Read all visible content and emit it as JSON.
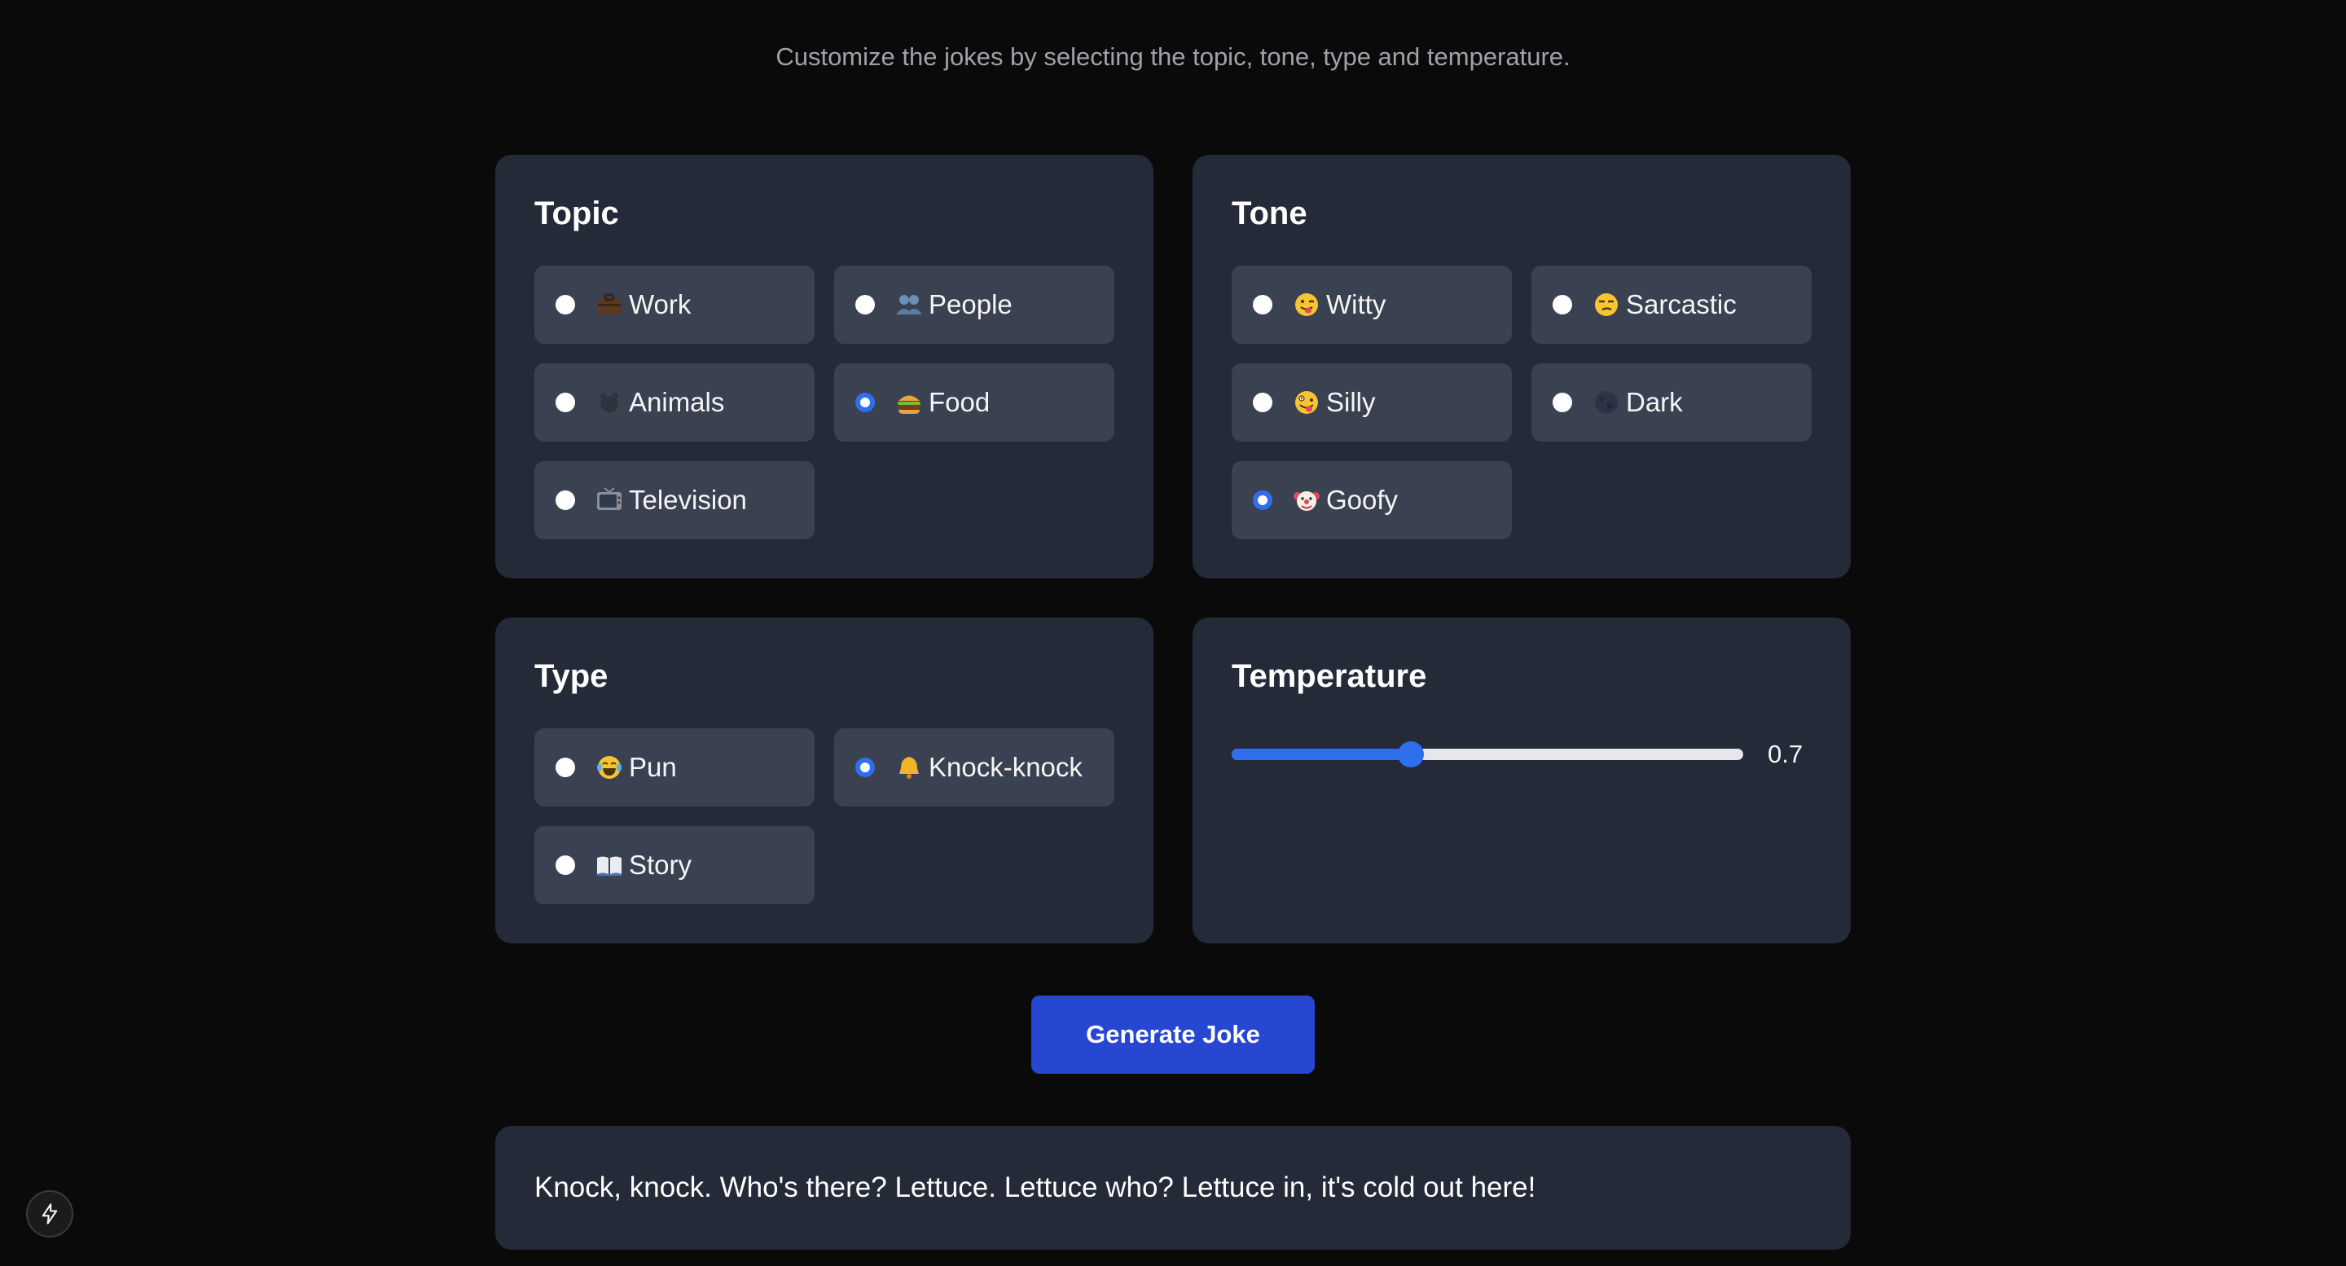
{
  "subtitle": "Customize the jokes by selecting the topic, tone, type and temperature.",
  "topic": {
    "title": "Topic",
    "options": [
      {
        "label": "Work",
        "icon": "briefcase-icon",
        "checked": false
      },
      {
        "label": "People",
        "icon": "people-icon",
        "checked": false
      },
      {
        "label": "Animals",
        "icon": "animal-icon",
        "checked": false
      },
      {
        "label": "Food",
        "icon": "burger-icon",
        "checked": true
      },
      {
        "label": "Television",
        "icon": "television-icon",
        "checked": false
      }
    ]
  },
  "tone": {
    "title": "Tone",
    "options": [
      {
        "label": "Witty",
        "icon": "winking-tongue-face-icon",
        "checked": false
      },
      {
        "label": "Sarcastic",
        "icon": "unamused-face-icon",
        "checked": false
      },
      {
        "label": "Silly",
        "icon": "zany-face-icon",
        "checked": false
      },
      {
        "label": "Dark",
        "icon": "new-moon-icon",
        "checked": false
      },
      {
        "label": "Goofy",
        "icon": "clown-face-icon",
        "checked": true
      }
    ]
  },
  "type": {
    "title": "Type",
    "options": [
      {
        "label": "Pun",
        "icon": "tears-of-joy-icon",
        "checked": false
      },
      {
        "label": "Knock-knock",
        "icon": "bell-icon",
        "checked": true
      },
      {
        "label": "Story",
        "icon": "open-book-icon",
        "checked": false
      }
    ]
  },
  "temperature": {
    "title": "Temperature",
    "value": 0.7,
    "value_label": "0.7",
    "min": 0,
    "max": 2
  },
  "generate_label": "Generate Joke",
  "joke": "Knock, knock. Who's there? Lettuce. Lettuce who? Lettuce in, it's cold out here!",
  "fab_icon": "lightning-icon",
  "colors": {
    "background": "#0a0a0b",
    "panel": "#242a38",
    "option": "#3a4150",
    "accent": "#2f6fed",
    "button": "#2747d3"
  }
}
